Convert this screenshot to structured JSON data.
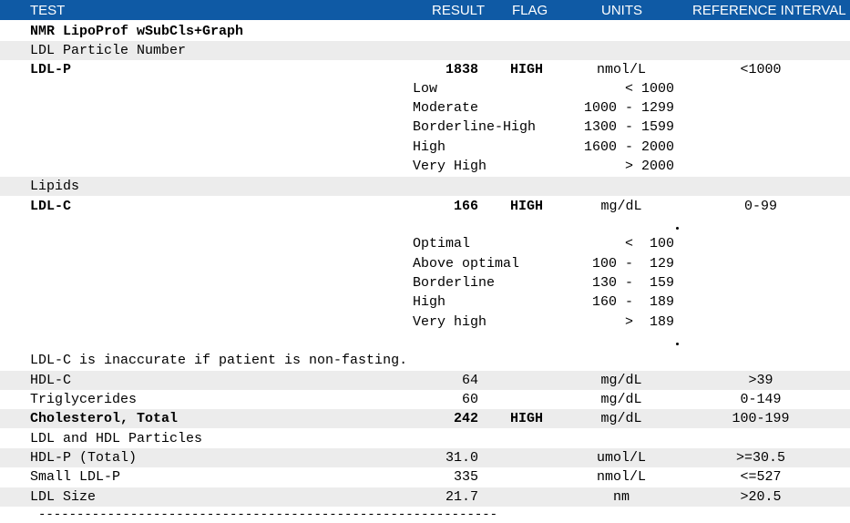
{
  "header": {
    "test": "TEST",
    "result": "RESULT",
    "flag": "FLAG",
    "units": "UNITS",
    "ref": "REFERENCE INTERVAL"
  },
  "panel_title": "NMR LipoProf wSubCls+Graph",
  "sections": {
    "ldl_particle_number": "LDL Particle Number",
    "lipids": "Lipids",
    "ldl_hdl_particles": "LDL and HDL Particles"
  },
  "ldl_p": {
    "name": "LDL-P",
    "result": "1838",
    "flag": "HIGH",
    "units": "nmol/L",
    "ref": "<1000",
    "ranges": [
      {
        "label": "Low",
        "value": "< 1000"
      },
      {
        "label": "Moderate",
        "value": "1000 - 1299"
      },
      {
        "label": "Borderline-High",
        "value": "1300 - 1599"
      },
      {
        "label": "High",
        "value": "1600 - 2000"
      },
      {
        "label": "Very High",
        "value": "> 2000"
      }
    ]
  },
  "ldl_c": {
    "name": "LDL-C",
    "result": "166",
    "flag": "HIGH",
    "units": "mg/dL",
    "ref": "0-99",
    "ranges": [
      {
        "label": "Optimal",
        "value": "<  100"
      },
      {
        "label": "Above optimal",
        "value": "100 -  129"
      },
      {
        "label": "Borderline",
        "value": "130 -  159"
      },
      {
        "label": "High",
        "value": "160 -  189"
      },
      {
        "label": "Very high",
        "value": ">  189"
      }
    ],
    "note": "LDL-C is inaccurate if patient is non-fasting."
  },
  "hdl_c": {
    "name": "HDL-C",
    "result": "64",
    "flag": "",
    "units": "mg/dL",
    "ref": ">39"
  },
  "trig": {
    "name": "Triglycerides",
    "result": "60",
    "flag": "",
    "units": "mg/dL",
    "ref": "0-149"
  },
  "chol": {
    "name": "Cholesterol, Total",
    "result": "242",
    "flag": "HIGH",
    "units": "mg/dL",
    "ref": "100-199"
  },
  "hdl_p": {
    "name": "HDL-P (Total)",
    "result": "31.0",
    "flag": "",
    "units": "umol/L",
    "ref": ">=30.5"
  },
  "small_ldl_p": {
    "name": "Small LDL-P",
    "result": "335",
    "flag": "",
    "units": "nmol/L",
    "ref": "<=527"
  },
  "ldl_size": {
    "name": "LDL Size",
    "result": "21.7",
    "flag": "",
    "units": "nm",
    "ref": ">20.5"
  },
  "divider": "------------------------------------------------------------"
}
